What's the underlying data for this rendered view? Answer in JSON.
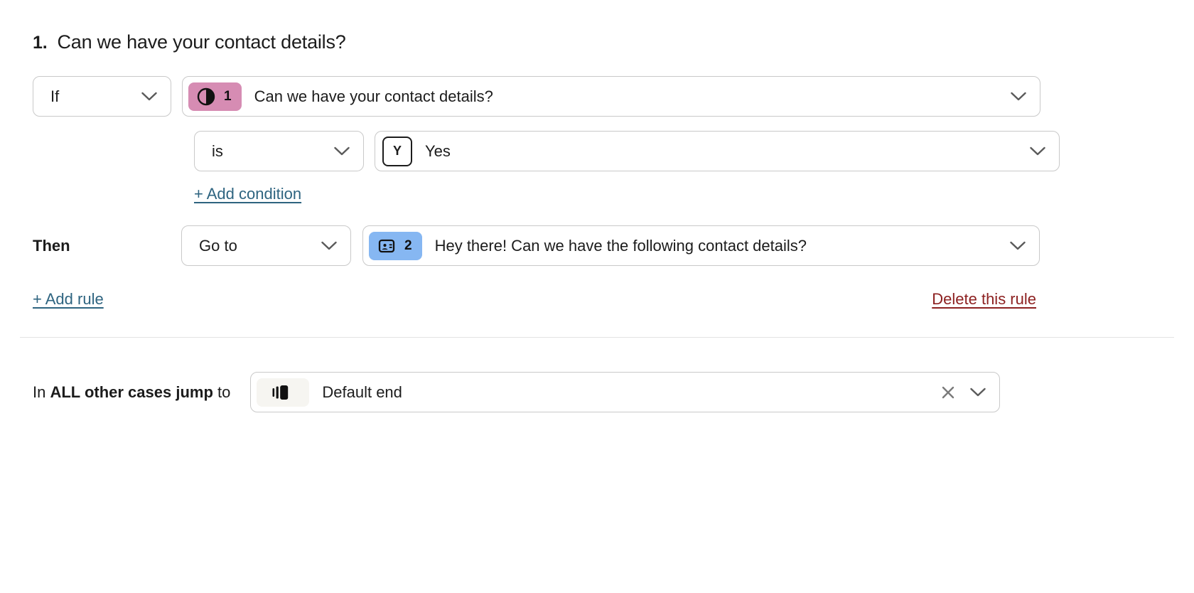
{
  "question": {
    "number": "1.",
    "title": "Can we have your contact details?"
  },
  "rule": {
    "if_label_value": "If",
    "if_target": {
      "badge_number": "1",
      "badge_icon": "half-circle-icon",
      "badge_color": "#d68cb3",
      "text": "Can we have your contact details?"
    },
    "operator_value": "is",
    "answer": {
      "key": "Y",
      "text": "Yes"
    },
    "add_condition_label": "+ Add condition",
    "then_label": "Then",
    "then_action_value": "Go to",
    "then_destination": {
      "badge_number": "2",
      "badge_icon": "contact-card-icon",
      "badge_color": "#86b7f2",
      "text": "Hey there! Can we have the following contact details?"
    },
    "add_rule_label": "+ Add rule",
    "delete_rule_label": "Delete this rule",
    "delete_color": "#8d2121",
    "link_color": "#2e6480"
  },
  "fallback": {
    "prefix": "In ",
    "emphasis": "ALL other cases jump",
    "suffix": " to",
    "destination": {
      "badge_icon": "ending-icon",
      "text": "Default end"
    },
    "clear_icon": "close-icon",
    "expand_icon": "chevron-down-icon"
  }
}
